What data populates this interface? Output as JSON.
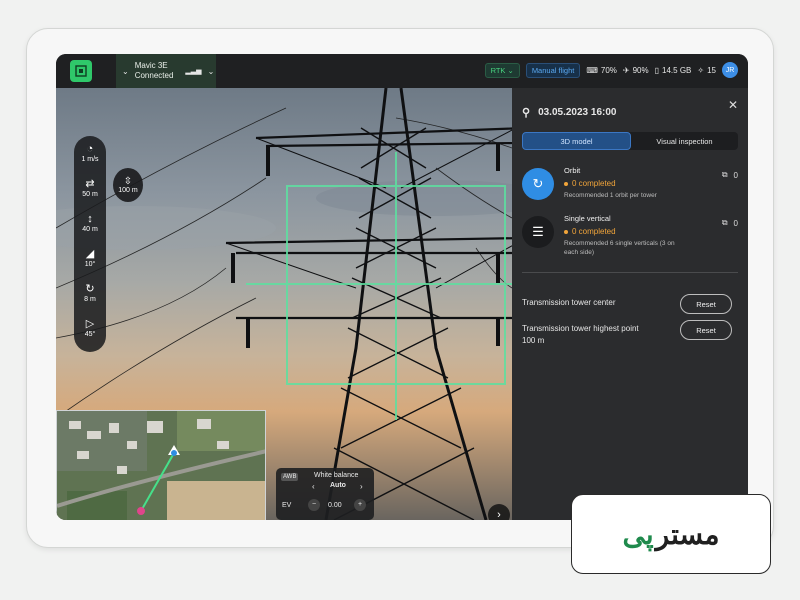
{
  "topbar": {
    "device_name": "Mavic 3E",
    "device_status": "Connected",
    "rtk": "RTK",
    "mode": "Manual flight",
    "battery_rc": "70%",
    "battery_drone": "90%",
    "storage": "14.5 GB",
    "satellites": "15",
    "avatar": "JR"
  },
  "tools": [
    {
      "icon": "speed-icon",
      "glyph": "◔",
      "value": "1 m/s"
    },
    {
      "icon": "distance-icon",
      "glyph": "⇄",
      "value": "50 m"
    },
    {
      "icon": "height-icon",
      "glyph": "↕",
      "value": "40 m"
    },
    {
      "icon": "gimbal-angle-icon",
      "glyph": "◢",
      "value": "10°"
    },
    {
      "icon": "radius-icon",
      "glyph": "↻",
      "value": "8 m"
    },
    {
      "icon": "fov-icon",
      "glyph": "▷",
      "value": "45°"
    }
  ],
  "altitude_button": "100 m",
  "white_balance": {
    "badge": "AWB",
    "title": "White balance",
    "value": "Auto",
    "ev_label": "EV",
    "ev_value": "0.00"
  },
  "panel": {
    "datetime": "03.05.2023 16:00",
    "tabs": [
      "3D model",
      "Visual inspection"
    ],
    "missions": [
      {
        "title": "Orbit",
        "status": "0 completed",
        "recommendation": "Recommended 1 orbit per tower",
        "count": "0",
        "color": "#2f8de4"
      },
      {
        "title": "Single vertical",
        "status": "0 completed",
        "recommendation": "Recommended 6 single verticals (3 on each side)",
        "count": "0",
        "color": "#1b1c1e"
      }
    ],
    "rows": [
      {
        "label": "Transmission tower center",
        "sub": "",
        "button": "Reset"
      },
      {
        "label": "Transmission tower highest point",
        "sub": "100 m",
        "button": "Reset"
      }
    ]
  },
  "watermark": {
    "text_green": "پی",
    "text_black": "مستر"
  },
  "colors": {
    "accent_green": "#2fc86a",
    "accent_blue": "#2f8de4",
    "status_orange": "#f0a43a",
    "grid_green": "#5de0a0"
  }
}
